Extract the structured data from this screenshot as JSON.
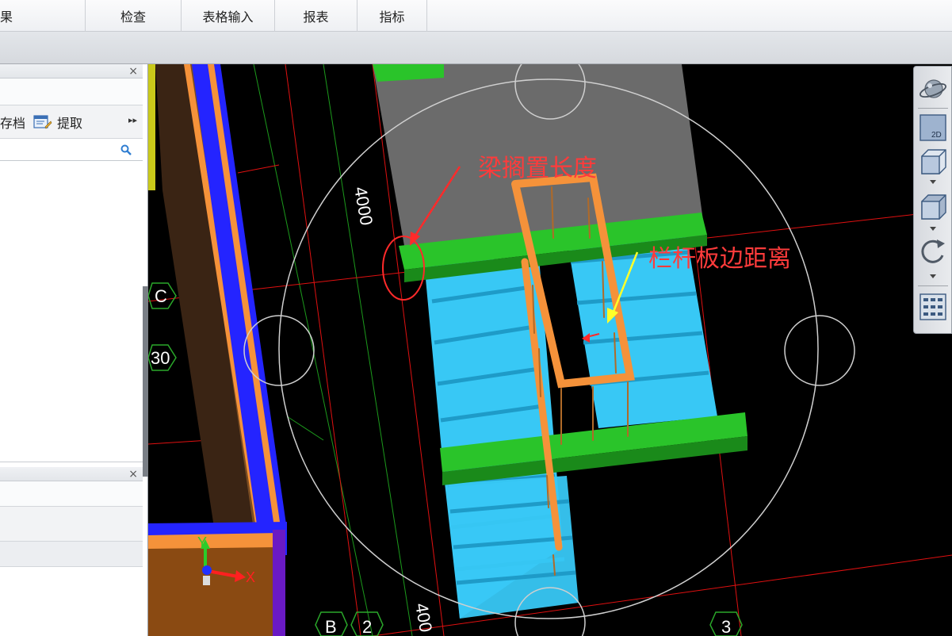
{
  "menu": {
    "items": [
      "果",
      "检查",
      "表格输入",
      "报表",
      "指标"
    ]
  },
  "left_panel": {
    "save_label": "存档",
    "extract_label": "提取",
    "more_glyph": "▸▸",
    "close_glyph": "×"
  },
  "viewport": {
    "dimension_labels": [
      "4000",
      "400"
    ],
    "axis_labels": [
      "C",
      "30",
      "B",
      "2",
      "3"
    ],
    "annotations": {
      "beam_rest_length": "梁搁置长度",
      "railing_edge_distance": "栏杆板边距离"
    },
    "gizmo": {
      "x": "X",
      "y": "Y"
    }
  },
  "view_toolbar": {
    "buttons": [
      "orbit-icon",
      "2d-view-icon",
      "3d-box-icon",
      "solid-box-icon",
      "rotate-icon",
      "layers-grid-icon"
    ],
    "twod_label": "2D"
  },
  "colors": {
    "annotation_red": "#ff3b3b",
    "arrow_yellow": "#ffff2a",
    "beam_green": "#2ac42a",
    "stair_blue": "#38c8f5",
    "railing_orange": "#f5923a",
    "grid_red": "#e01010",
    "grid_green": "#1c9a1c"
  }
}
